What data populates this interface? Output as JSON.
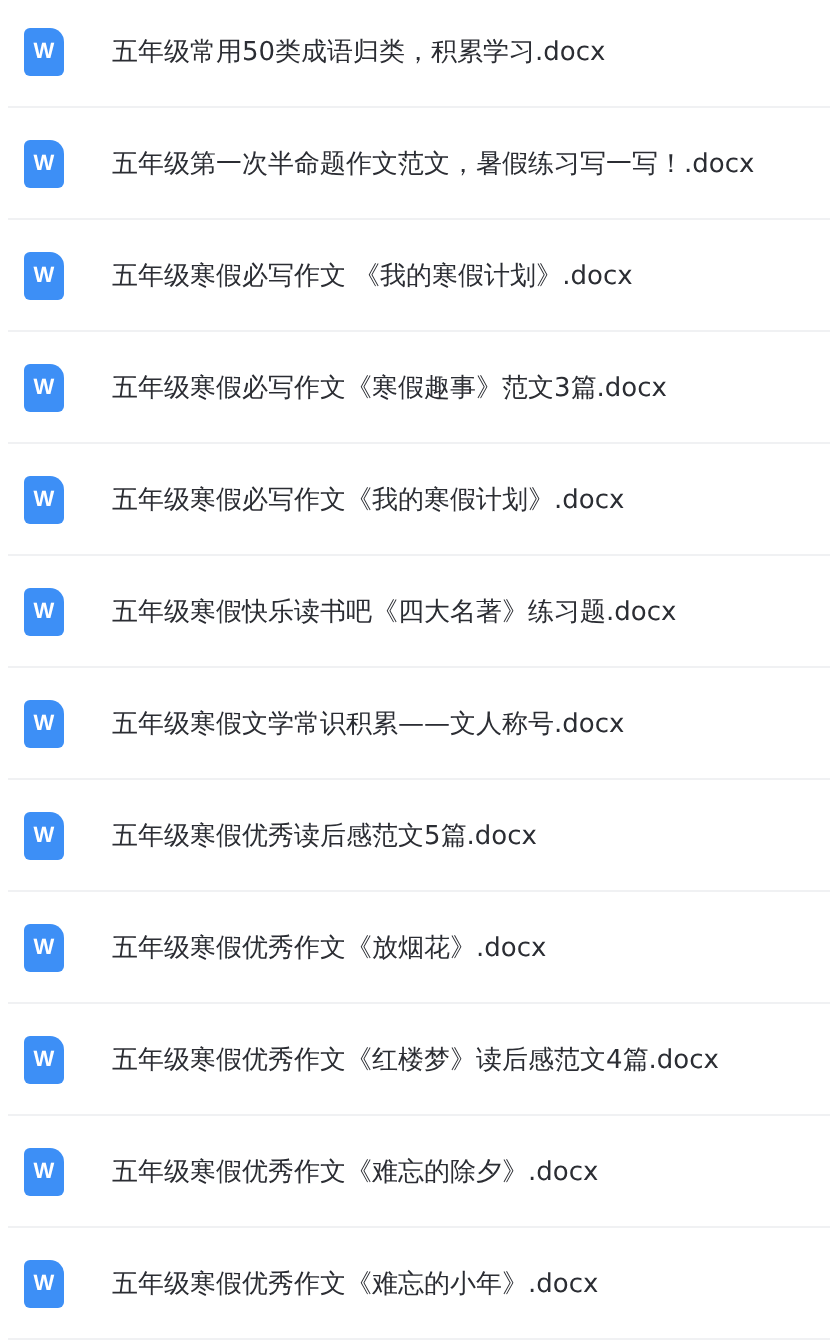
{
  "files": [
    {
      "icon_text": "W",
      "name": "五年级常用50类成语归类，积累学习.docx"
    },
    {
      "icon_text": "W",
      "name": "五年级第一次半命题作文范文，暑假练习写一写！.docx"
    },
    {
      "icon_text": "W",
      "name": "五年级寒假必写作文 《我的寒假计划》.docx"
    },
    {
      "icon_text": "W",
      "name": "五年级寒假必写作文《寒假趣事》范文3篇.docx"
    },
    {
      "icon_text": "W",
      "name": "五年级寒假必写作文《我的寒假计划》.docx"
    },
    {
      "icon_text": "W",
      "name": "五年级寒假快乐读书吧《四大名著》练习题.docx"
    },
    {
      "icon_text": "W",
      "name": "五年级寒假文学常识积累——文人称号.docx"
    },
    {
      "icon_text": "W",
      "name": "五年级寒假优秀读后感范文5篇.docx"
    },
    {
      "icon_text": "W",
      "name": "五年级寒假优秀作文《放烟花》.docx"
    },
    {
      "icon_text": "W",
      "name": "五年级寒假优秀作文《红楼梦》读后感范文4篇.docx"
    },
    {
      "icon_text": "W",
      "name": "五年级寒假优秀作文《难忘的除夕》.docx"
    },
    {
      "icon_text": "W",
      "name": "五年级寒假优秀作文《难忘的小年》.docx"
    }
  ]
}
